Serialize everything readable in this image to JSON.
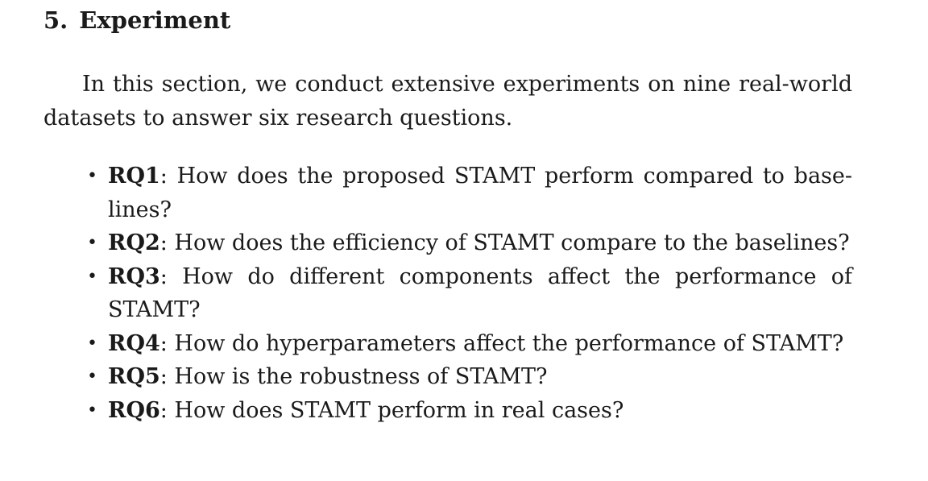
{
  "section": {
    "number": "5.",
    "title": "Experiment"
  },
  "intro": "In this section, we conduct extensive experiments on nine real-world datasets to answer six research questions.",
  "research_questions": [
    {
      "id": "RQ1",
      "text": ": How does the proposed STAMT perform compared to base­lines?"
    },
    {
      "id": "RQ2",
      "text": ": How does the efficiency of STAMT compare to the base­lines?"
    },
    {
      "id": "RQ3",
      "text": ": How do different components affect the performance of STAMT?"
    },
    {
      "id": "RQ4",
      "text": ": How do hyperparameters affect the performance of STAMT?"
    },
    {
      "id": "RQ5",
      "text": ": How is the robustness of STAMT?"
    },
    {
      "id": "RQ6",
      "text": ": How does STAMT perform in real cases?"
    }
  ]
}
